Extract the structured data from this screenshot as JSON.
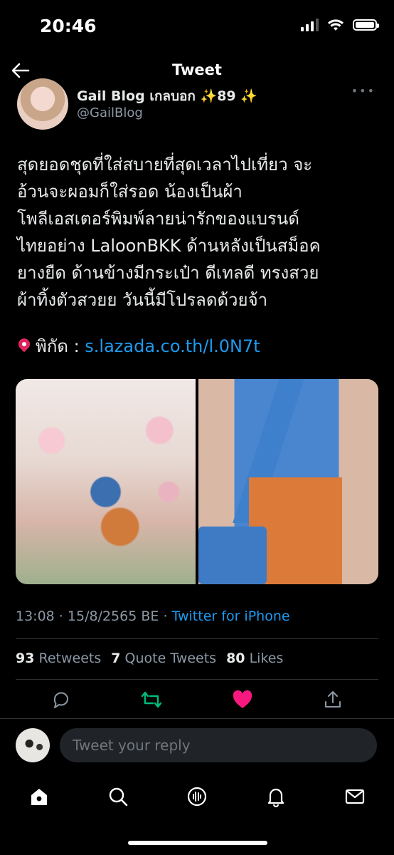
{
  "status_bar": {
    "time": "20:46"
  },
  "header": {
    "title": "Tweet",
    "back_icon": "arrow-left-icon"
  },
  "author": {
    "display_name": "Gail Blog เกลบอก ✨89 ✨",
    "handle": "@GailBlog"
  },
  "tweet": {
    "text": "สุดยอดชุดที่ใส่สบายที่สุดเวลาไปเที่ยว จะ\nอ้วนจะผอมก็ใส่รอด น้องเป็นผ้า\nโพลีเอสเตอร์พิมพ์ลายน่ารักของแบรนด์\nไทยอย่าง LaloonBKK ด้านหลังเป็นสม็อค\nยางยืด ด้านข้างมีกระเป๋า ดีเทลดี ทรงสวย\nผ้าทิ้งตัวสวยย วันนี้มีโปรลดด้วยจ้า",
    "location_label": "พิกัด : ",
    "link": "s.lazada.co.th/l.0N7t"
  },
  "meta": {
    "time": "13:08",
    "date": "15/8/2565 BE",
    "source": "Twitter for iPhone"
  },
  "stats": {
    "retweets_count": "93",
    "retweets_label": "Retweets",
    "quotes_count": "7",
    "quotes_label": "Quote Tweets",
    "likes_count": "80",
    "likes_label": "Likes"
  },
  "actions": {
    "reply_icon": "comment-icon",
    "retweet_icon": "retweet-icon",
    "like_icon": "heart-icon",
    "share_icon": "share-icon",
    "retweet_color": "#00ba7c",
    "like_color": "#f91880"
  },
  "reply_bar": {
    "placeholder": "Tweet your reply"
  },
  "tabbar": {
    "items": [
      "home-icon",
      "search-icon",
      "spaces-icon",
      "bell-icon",
      "mail-icon"
    ]
  },
  "colors": {
    "link": "#1d9bf0",
    "background": "#000000",
    "secondary_text": "#8b98a5"
  }
}
